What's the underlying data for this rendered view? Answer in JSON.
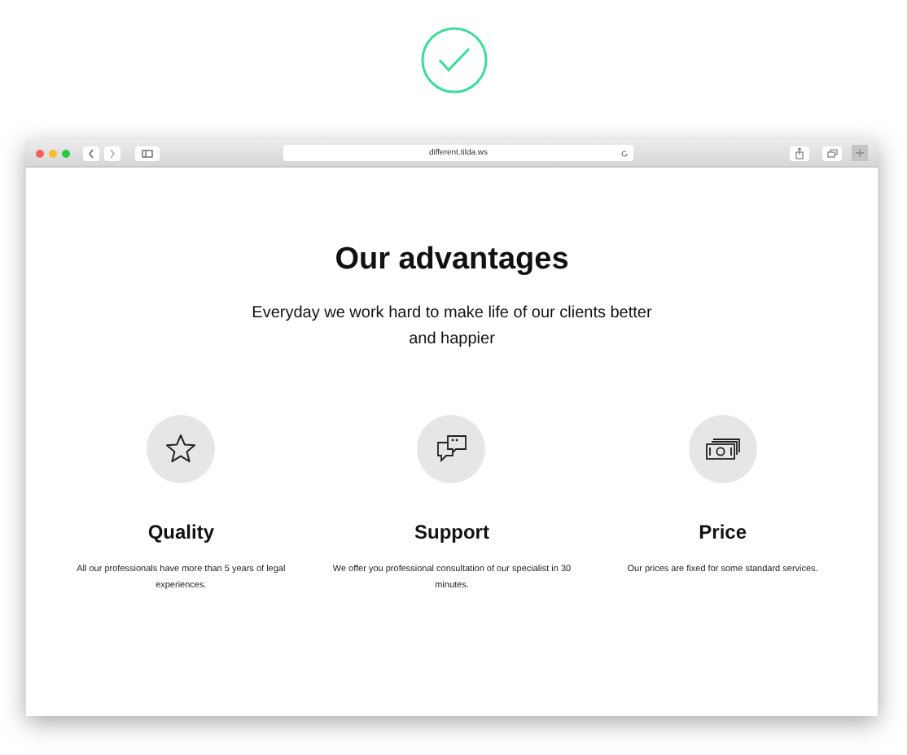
{
  "browser": {
    "url": "different.tilda.ws"
  },
  "page": {
    "title": "Our advantages",
    "subtitle": "Everyday we work hard to make life of our clients better and happier"
  },
  "features": [
    {
      "kind": "star",
      "title": "Quality",
      "text": "All our professionals have more than 5 years of legal experiences."
    },
    {
      "kind": "chat",
      "title": "Support",
      "text": "We offer you professional consultation of our specialist in 30 minutes."
    },
    {
      "kind": "money",
      "title": "Price",
      "text": "Our prices are fixed for some standard services."
    }
  ]
}
